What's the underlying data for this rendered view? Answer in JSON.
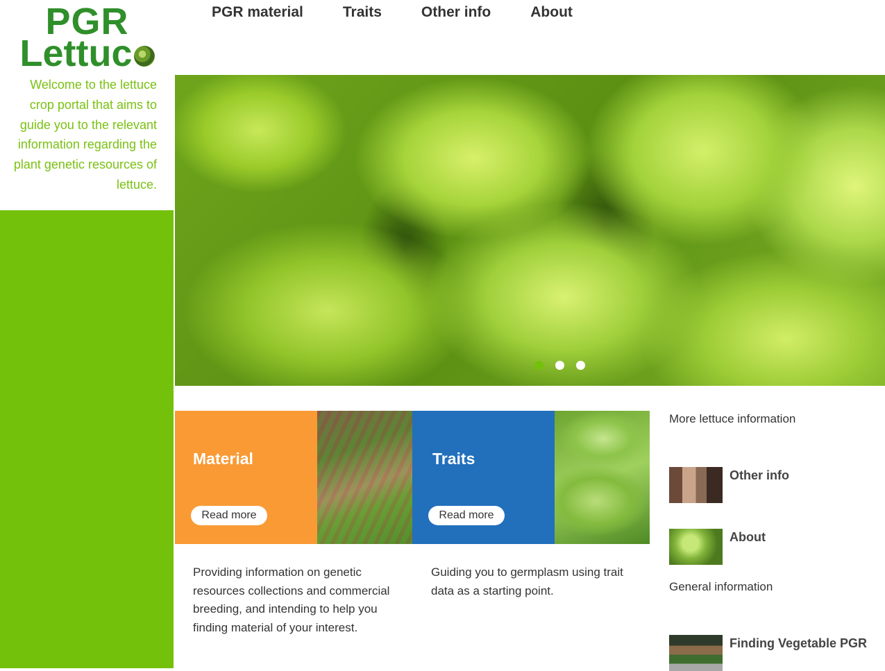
{
  "logo": {
    "line1": "PGR",
    "line2": "Lettuc"
  },
  "welcome_text": "Welcome to the lettuce crop portal that aims to guide you to the relevant information regarding the plant genetic resources of lettuce.",
  "nav": [
    "PGR material",
    "Traits",
    "Other info",
    "About"
  ],
  "slider": {
    "slide_count": 3,
    "active_index": 0
  },
  "tiles": [
    {
      "title": "Material",
      "button": "Read more",
      "color": "#f99a35",
      "description": "Providing information on genetic resources collections and commercial breeding, and intending to help you finding material of your interest."
    },
    {
      "title": "Traits",
      "button": "Read more",
      "color": "#226fbc",
      "description": "Guiding you to germplasm using trait data as a starting point."
    }
  ],
  "sidebar_right": {
    "heading1": "More lettuce information",
    "items1": [
      {
        "label": "Other info"
      },
      {
        "label": "About"
      }
    ],
    "heading2": "General information",
    "items2": [
      {
        "label": "Finding Vegetable PGR"
      }
    ]
  },
  "colors": {
    "brand_green": "#74c10b",
    "logo_green": "#2f8f2a"
  }
}
